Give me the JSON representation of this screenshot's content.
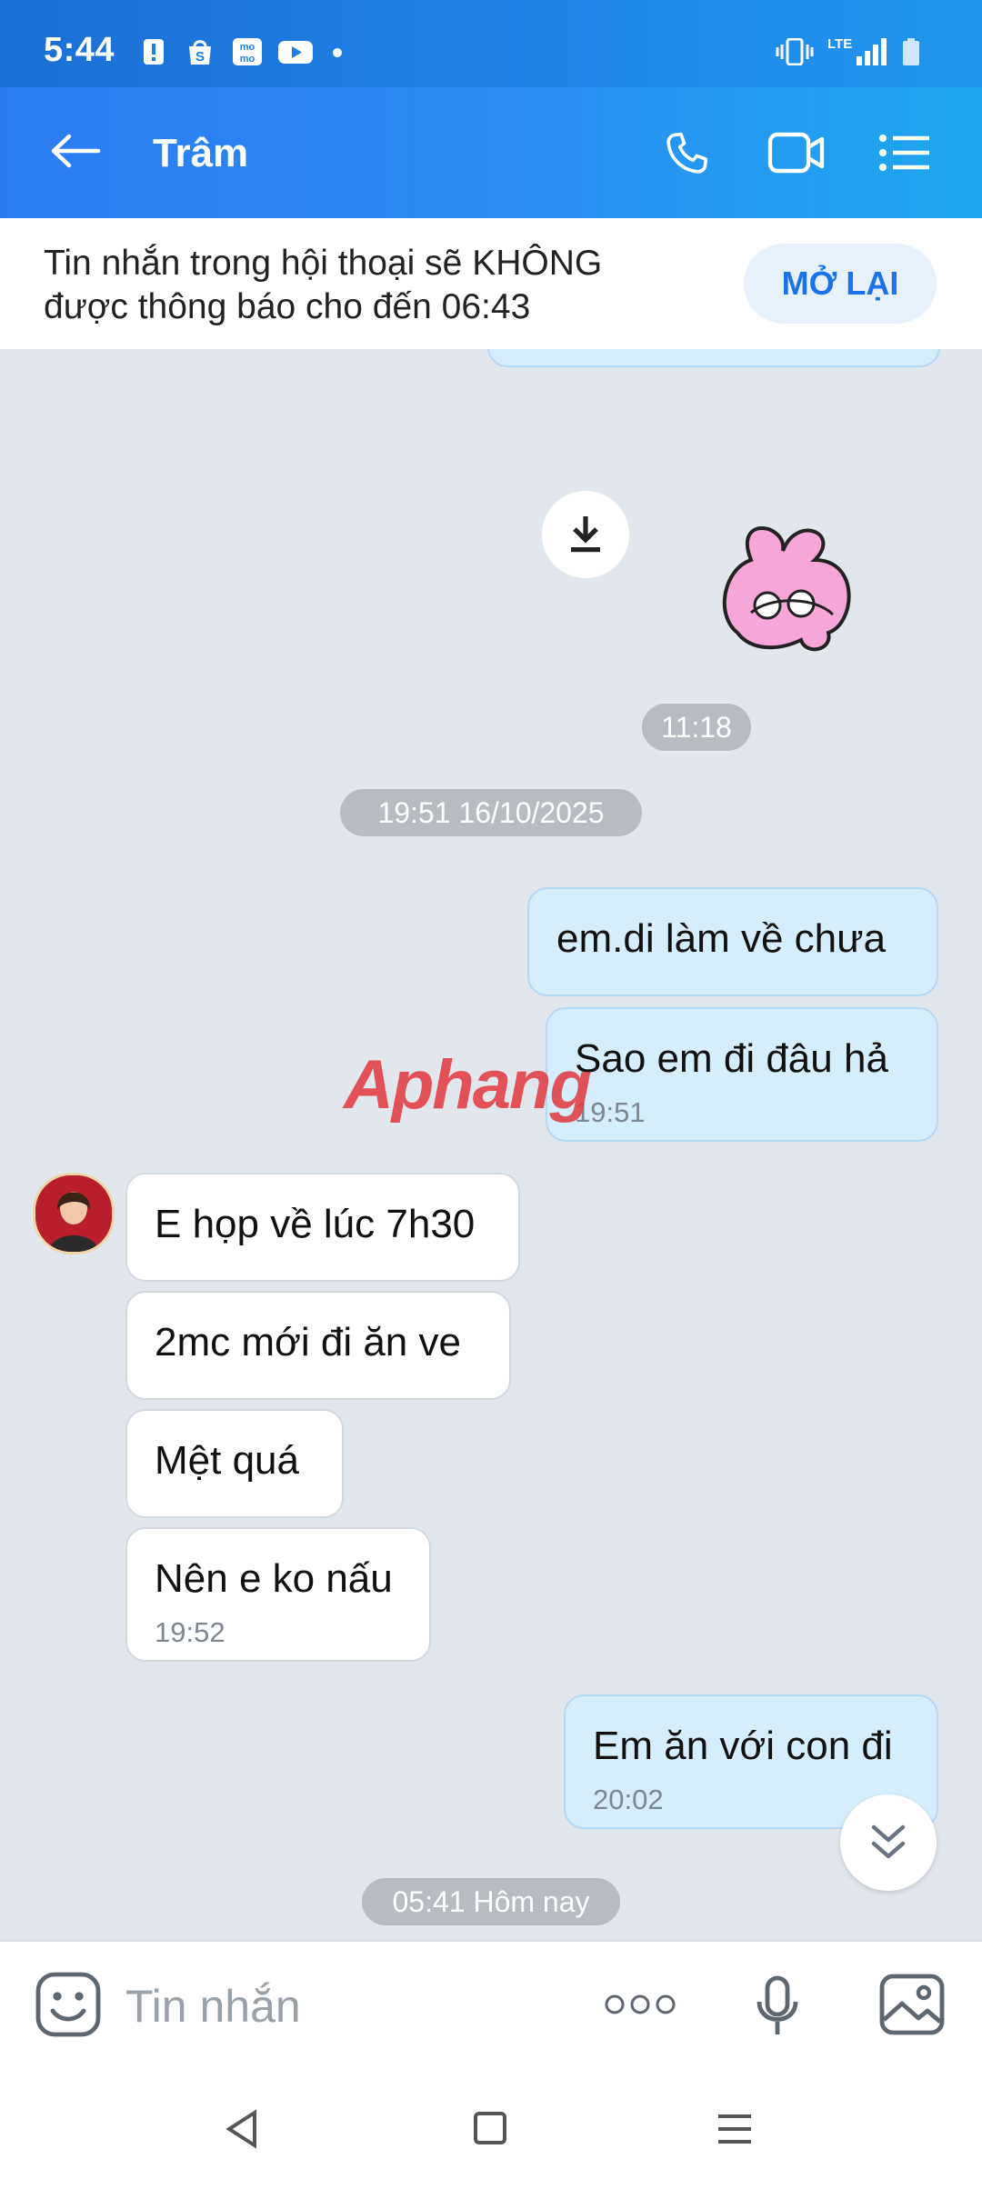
{
  "status": {
    "time": "5:44",
    "network": "LTE",
    "icons": [
      "alert-icon",
      "shopee-icon",
      "momo-icon",
      "youtube-icon",
      "dot-icon",
      "vibrate-icon",
      "signal-icon",
      "battery-icon"
    ]
  },
  "header": {
    "contact_name": "Trâm",
    "icons": [
      "back-arrow-icon",
      "phone-icon",
      "video-call-icon",
      "menu-list-icon"
    ]
  },
  "banner": {
    "text": "Tin nhắn trong hội thoại sẽ KHÔNG được thông báo cho đến 06:43",
    "button": "MỞ LẠI"
  },
  "chat": {
    "sticker_time": "11:18",
    "date_divider": "19:51 16/10/2025",
    "today_divider": "05:41 Hôm nay",
    "messages": [
      {
        "from": "me",
        "text": "em.di làm về chưa",
        "time": ""
      },
      {
        "from": "me",
        "text": "Sao em đi đâu hả",
        "time": "19:51"
      },
      {
        "from": "them",
        "text": "E họp về lúc 7h30",
        "time": ""
      },
      {
        "from": "them",
        "text": "2mc mới đi ăn ve",
        "time": ""
      },
      {
        "from": "them",
        "text": "Mệt quá",
        "time": ""
      },
      {
        "from": "them",
        "text": "Nên e ko nấu",
        "time": "19:52"
      },
      {
        "from": "me",
        "text": "Em ăn với con đi",
        "time": "20:02"
      }
    ],
    "watermark": "Aphang"
  },
  "composer": {
    "placeholder": "Tin nhắn"
  },
  "colors": {
    "header_blue": "#2a8ff4",
    "outgoing_bubble": "#d6edfc",
    "incoming_bubble": "#ffffff",
    "chat_bg": "#e2e7ee",
    "accent": "#1a73e8"
  }
}
